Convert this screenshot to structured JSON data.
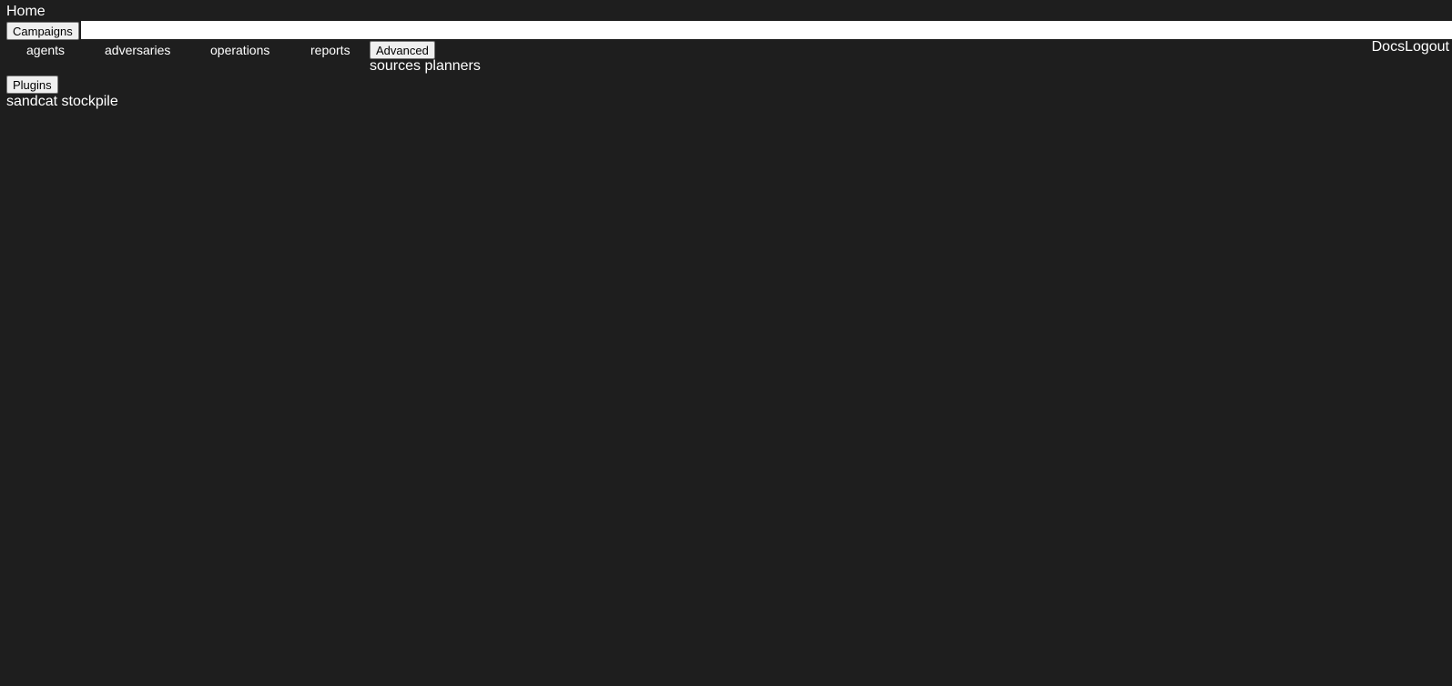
{
  "header": {
    "home_label": "Home",
    "docs_label": "Docs",
    "logout_label": "Logout"
  },
  "campaigns": {
    "button_label": "Campaigns",
    "items": [
      {
        "label": "agents"
      },
      {
        "label": "adversaries"
      },
      {
        "label": "operations"
      },
      {
        "label": "reports"
      }
    ]
  },
  "advanced": {
    "button_label": "Advanced",
    "items": [
      {
        "label": "sources"
      },
      {
        "label": "planners"
      }
    ]
  },
  "plugins": {
    "button_label": "Plugins",
    "items": [
      {
        "label": "sandcat"
      },
      {
        "label": "stockpile"
      }
    ]
  },
  "colors": {
    "background": "#1e1e1e",
    "text": "#ffffff",
    "button_bg": "#efefef"
  }
}
